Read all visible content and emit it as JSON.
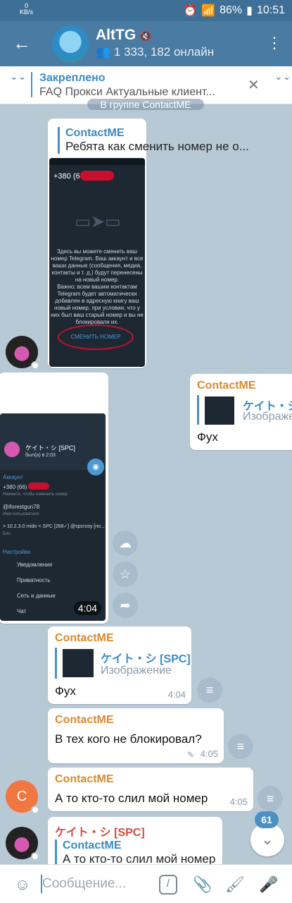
{
  "status_bar": {
    "speed_value": "0",
    "speed_unit": "KB/s",
    "battery": "86%",
    "time": "10:51"
  },
  "header": {
    "back_icon": "arrow-left-icon",
    "title": "AltTG",
    "subtitle": "1 333, 182 онлайн",
    "menu_icon": "dots-vertical-icon"
  },
  "pinned": {
    "label": "Закреплено",
    "text": "FAQ  Прокси  Актуальные клиент..."
  },
  "date_chip": "В группе ContactME",
  "messages": {
    "m1": {
      "reply_name": "ContactME",
      "reply_text": "Ребята как сменить номер не о...",
      "screenshot": {
        "phone": "+380 (66)",
        "body": "Здесь вы можете сменить ваш номер Telegram. Ваш аккаунт и все ваши данные (сообщения, медиа, контакты и т. д.) будут перенесены на новый номер.",
        "note": "Важно: всем вашим контактам Telegram будет автоматически добавлен в адресную книгу ваш новый номер, при условии, что у них был ваш старый номер и вы не блокировали их.",
        "button": "СМЕНИТЬ НОМЕР"
      }
    },
    "m2": {
      "sender": "ContactME",
      "reply_name": "ケイト・シ",
      "reply_text": "Изображе",
      "text": "Фух"
    },
    "m3": {
      "time": "4:04",
      "screenshot": {
        "name": "ケイト・シ [SPC]",
        "seen": "был(а) в 2:03",
        "section_account": "Аккаунт",
        "phone": "+380 (66)",
        "phone_hint": "Нажмите, чтобы изменить номер",
        "username": "@iforestgun78",
        "username_hint": "Имя пользователя",
        "bio": "> 10.2.3.0 mido < SPC [268✓] @spcrosy [no...",
        "bio_hint": "Био",
        "section_settings": "Настройки",
        "items": [
          "Уведомления",
          "Приватность",
          "Сеть и данные",
          "Чат"
        ]
      }
    },
    "m4": {
      "sender": "ContactME",
      "reply_name": "ケイト・シ [SPC]",
      "reply_text": "Изображение",
      "text": "Фух",
      "time": "4:04"
    },
    "m5": {
      "sender": "ContactME",
      "text": "В тех кого не блокировал?",
      "time": "4:05"
    },
    "m6": {
      "avatar_letter": "С",
      "sender": "ContactME",
      "text": "А то кто-то слил мой номер",
      "time": "4:05"
    },
    "m7": {
      "sender": "ケイト・シ [SPC]",
      "reply_name": "ContactME",
      "reply_text": "А то кто-то слил мой номер"
    }
  },
  "scroll_badge": "61",
  "composer": {
    "placeholder": "Сообщение...",
    "icons": [
      "emoji-icon",
      "slash-command-icon",
      "attach-icon",
      "sticker-icon",
      "microphone-icon"
    ]
  },
  "colors": {
    "header": "#4a7ba3",
    "accent": "#3a8bc3",
    "sender_orange": "#d88a2e",
    "sender_red": "#d24a43",
    "background": "#b8c9d6"
  }
}
